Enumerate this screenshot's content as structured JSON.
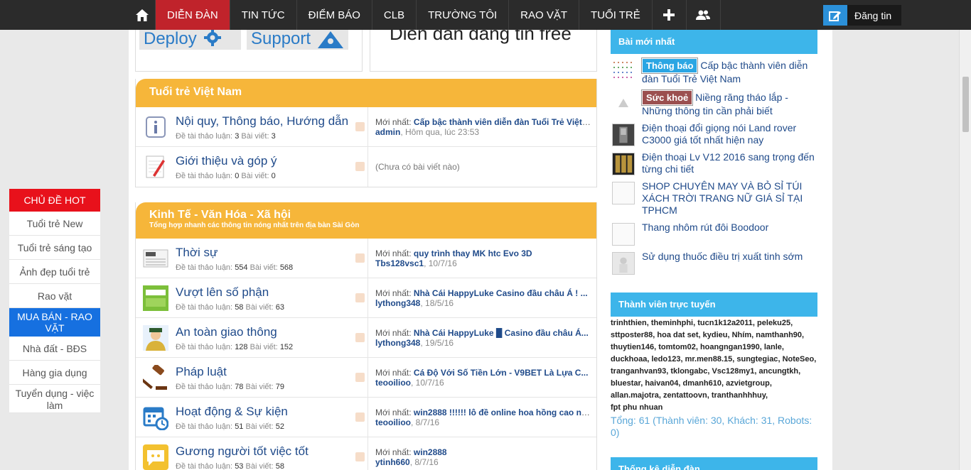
{
  "nav": {
    "items": [
      "DIỄN ĐÀN",
      "TIN TỨC",
      "ĐIỂM BÁO",
      "CLB",
      "TRƯỜNG TÔI",
      "RAO VẶT",
      "TUỔI TRẺ"
    ],
    "post_button": "Đăng tin",
    "icons": [
      "home-icon",
      "plus-icon",
      "users-icon",
      "edit-icon"
    ]
  },
  "banner": {
    "tile1": "Deploy",
    "tile2": "Support",
    "headline": "Diễn đàn đăng tin free"
  },
  "categories": [
    {
      "title": "Tuổi trẻ Việt Nam",
      "subtitle": "",
      "forums": [
        {
          "name": "Nội quy, Thông báo, Hướng dẫn",
          "threads": "3",
          "posts": "3",
          "latest_title": "Cấp bậc thành viên diễn đàn Tuổi Trẻ Việt ...",
          "latest_user": "admin",
          "latest_time": "Hôm qua, lúc 23:53",
          "empty": ""
        },
        {
          "name": "Giới thiệu và góp ý",
          "threads": "0",
          "posts": "0",
          "latest_title": "",
          "latest_user": "",
          "latest_time": "",
          "empty": "(Chưa có bài viết nào)"
        }
      ]
    },
    {
      "title": "Kinh Tế - Văn Hóa - Xã hội",
      "subtitle": "Tổng hợp nhanh các thông tin nóng nhất trên địa bàn Sài Gòn",
      "forums": [
        {
          "name": "Thời sự",
          "threads": "554",
          "posts": "568",
          "latest_title": "quy trình thay MK htc Evo 3D",
          "latest_user": "Tbs128vsc1",
          "latest_time": "10/7/16",
          "empty": ""
        },
        {
          "name": "Vượt lên số phận",
          "threads": "58",
          "posts": "63",
          "latest_title": "Nhà Cái HappyLuke Casino đầu châu Á ! ...",
          "latest_user": "lythong348",
          "latest_time": "18/5/16",
          "empty": ""
        },
        {
          "name": "An toàn giao thông",
          "threads": "128",
          "posts": "152",
          "latest_title": "Nhà Cái HappyLuke █ Casino đầu châu Á...",
          "latest_user": "lythong348",
          "latest_time": "19/5/16",
          "empty": ""
        },
        {
          "name": "Pháp luật",
          "threads": "78",
          "posts": "79",
          "latest_title": "Cá Độ Với Số Tiền Lớn - V9BET Là Lựa C...",
          "latest_user": "teooilioo",
          "latest_time": "10/7/16",
          "empty": ""
        },
        {
          "name": "Hoạt động & Sự kiện",
          "threads": "51",
          "posts": "52",
          "latest_title": "win2888 !!!!!! lô đề online hoa hồng cao nh...",
          "latest_user": "teooilioo",
          "latest_time": "8/7/16",
          "empty": ""
        },
        {
          "name": "Gương người tốt việc tốt",
          "threads": "53",
          "posts": "58",
          "latest_title": "win2888",
          "latest_user": "ytinh660",
          "latest_time": "8/7/16",
          "empty": ""
        }
      ]
    }
  ],
  "labels": {
    "threads": "Đề tài thảo luận:",
    "posts": "Bài viết:",
    "latest": "Mới nhất:"
  },
  "hot": {
    "head1": "CHỦ ĐỀ HOT",
    "items1": [
      "Tuổi trẻ New",
      "Tuổi trẻ sáng tạo",
      "Ảnh đẹp tuổi trẻ",
      "Rao vặt"
    ],
    "head2": "MUA BÁN - RAO VẶT",
    "items2": [
      "Nhà đất - BĐS",
      "Hàng gia dụng",
      "Tuyển dụng - việc làm"
    ]
  },
  "sidebar": {
    "latest_head": "Bài mới nhất",
    "news": [
      {
        "badge": "Thông báo",
        "badge_color": "#2ba6e3",
        "text": "Cấp bậc thành viên diễn đàn Tuổi Trẻ Việt Nam"
      },
      {
        "badge": "Sức khoẻ",
        "badge_color": "#9b4f4f",
        "text": "Niềng răng tháo lắp - Những thông tin cần phải biết"
      },
      {
        "badge": "",
        "badge_color": "",
        "text": "Điện thoại đổi giọng nói Land rover C3000 giá tốt nhất hiện nay"
      },
      {
        "badge": "",
        "badge_color": "",
        "text": "Điện thoại Lv V12 2016 sang trọng đến từng chi tiết"
      },
      {
        "badge": "",
        "badge_color": "",
        "text": "SHOP CHUYÊN MAY VÀ BỎ SỈ TÚI XÁCH TRỜI TRANG NỮ GIÁ SỈ TẠI TPHCM"
      },
      {
        "badge": "",
        "badge_color": "",
        "text": "Thang nhôm rút đôi Boodoor"
      },
      {
        "badge": "",
        "badge_color": "",
        "text": "Sử dụng thuốc điều trị xuất tinh sớm"
      }
    ],
    "online_head": "Thành viên trực tuyến",
    "online_users": [
      "trinhthien",
      "theminhphi",
      "tucn1k12a2011",
      "peleku25",
      "sttposter88",
      "hoa dat set",
      "kydieu",
      "Nhím",
      "namthanh90",
      "thuytien146",
      "tomtom02",
      "hoangngan1990",
      "lanle",
      "duckhoaa",
      "ledo123",
      "mr.men88.15",
      "sungtegiac",
      "NoteSeo",
      "tranganhvan93",
      "tklongabc",
      "Vsc128my1",
      "ancungtkh",
      "bluestar",
      "haivan04",
      "dmanh610",
      "azvietgroup",
      "allan.majotra",
      "zentattoovn",
      "tranthanhhhuy",
      "fpt phu nhuan"
    ],
    "online_total": "Tổng: 61 (Thành viên: 30, Khách: 31, Robots: 0)",
    "stats_head": "Thống kê diễn đàn"
  }
}
